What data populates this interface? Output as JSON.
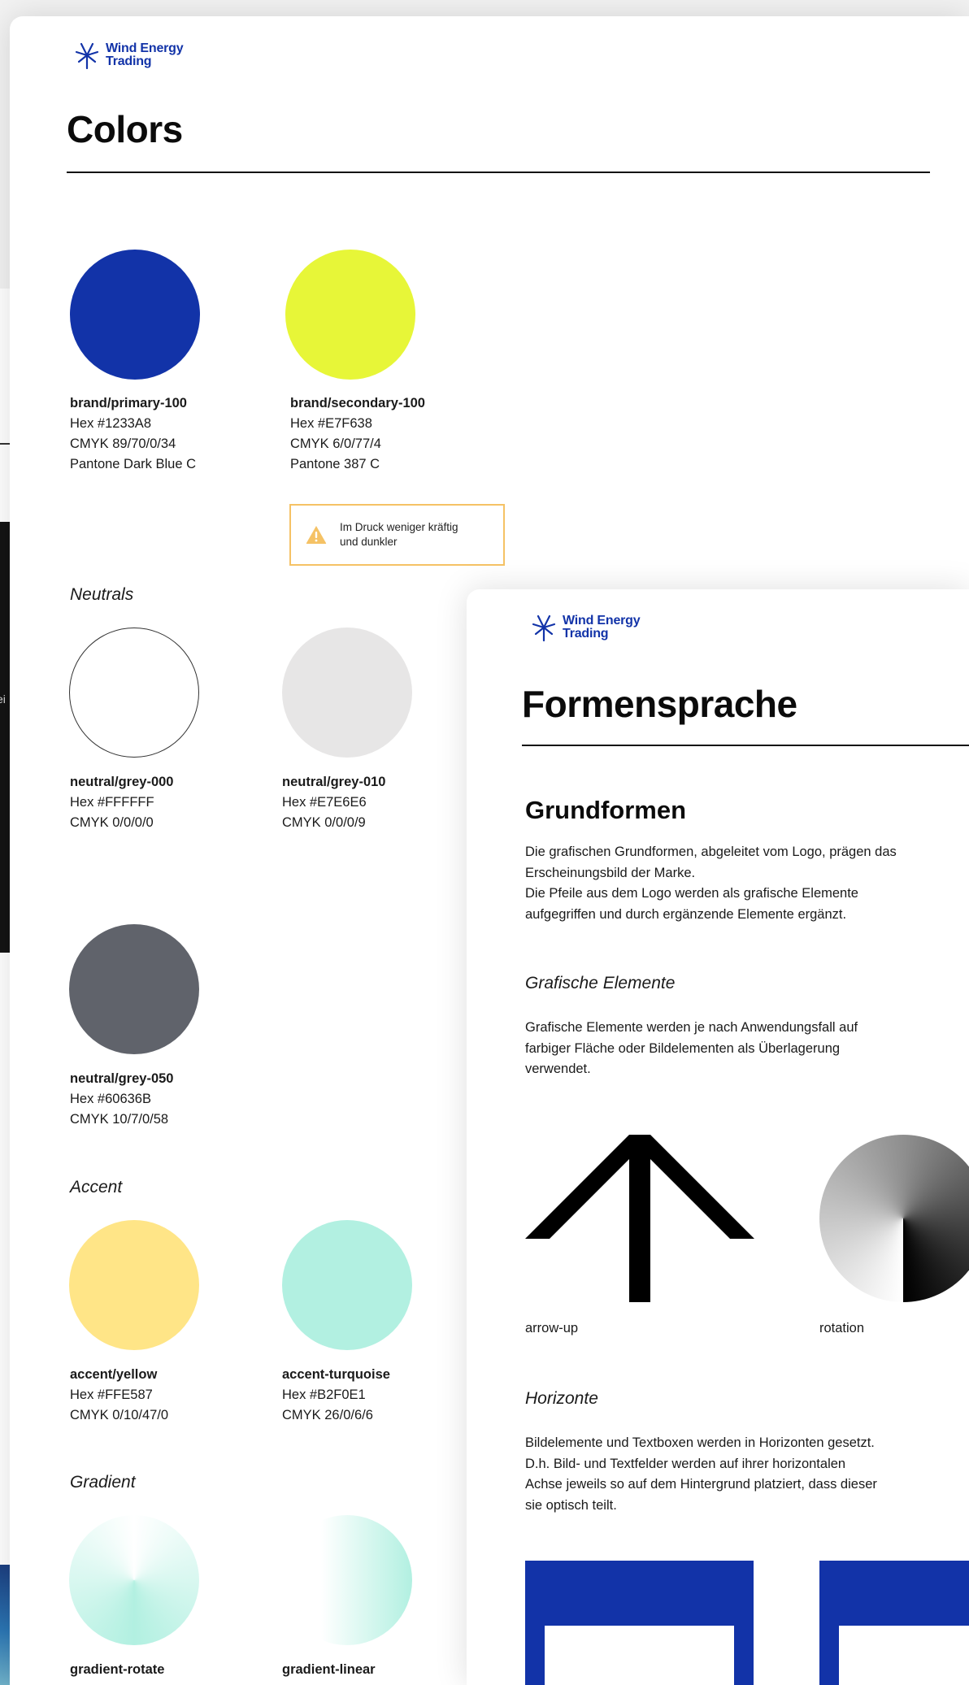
{
  "brand": {
    "logo_line1": "Wind Energy",
    "logo_line2": "Trading",
    "primary": "#1233A8"
  },
  "background": {
    "fragment_text": "ei"
  },
  "colors_page": {
    "title": "Colors",
    "swatches": [
      {
        "name": "brand/primary-100",
        "hex": "Hex #1233A8",
        "cmyk": "CMYK 89/70/0/34",
        "pantone": "Pantone Dark Blue C",
        "color": "#1233A8"
      },
      {
        "name": "brand/secondary-100",
        "hex": "Hex #E7F638",
        "cmyk": "CMYK 6/0/77/4",
        "pantone": "Pantone 387 C",
        "color": "#E7F638"
      }
    ],
    "warning": {
      "icon": "warning-icon",
      "text_line1": "Im Druck weniger kräftig",
      "text_line2": "und dunkler",
      "color": "#F5C265"
    },
    "neutrals": {
      "label": "Neutrals",
      "swatches": [
        {
          "name": "neutral/grey-000",
          "hex": "Hex #FFFFFF",
          "cmyk": "CMYK 0/0/0/0",
          "color": "#FFFFFF"
        },
        {
          "name": "neutral/grey-010",
          "hex": "Hex #E7E6E6",
          "cmyk": "CMYK 0/0/0/9",
          "color": "#E7E6E6"
        },
        {
          "name": "neutral/grey-050",
          "hex": "Hex #60636B",
          "cmyk": "CMYK 10/7/0/58",
          "color": "#60636B"
        }
      ]
    },
    "accent": {
      "label": "Accent",
      "swatches": [
        {
          "name": "accent/yellow",
          "hex": "Hex #FFE587",
          "cmyk": "CMYK 0/10/47/0",
          "color": "#FFE587"
        },
        {
          "name": "accent-turquoise",
          "hex": "Hex #B2F0E1",
          "cmyk": "CMYK 26/0/6/6",
          "color": "#B2F0E1"
        }
      ]
    },
    "gradient": {
      "label": "Gradient",
      "swatches": [
        {
          "name": "gradient-rotate"
        },
        {
          "name": "gradient-linear"
        }
      ]
    }
  },
  "forms_page": {
    "title": "Formensprache",
    "section_title": "Grundformen",
    "intro": [
      "Die grafischen Grundformen, abgeleitet vom Logo, prägen das",
      "Erscheinungsbild der Marke.",
      "Die Pfeile aus dem Logo werden als grafische Elemente",
      "aufgegriffen und durch ergänzende Elemente ergänzt."
    ],
    "elements": {
      "label": "Grafische Elemente",
      "text": [
        "Grafische Elemente werden je nach Anwendungsfall auf",
        "farbiger Fläche oder Bildelementen als Überlagerung",
        "verwendet."
      ],
      "items": [
        {
          "caption": "arrow-up",
          "icon": "arrow-up-icon"
        },
        {
          "caption": "rotation",
          "icon": "rotation-icon"
        }
      ]
    },
    "horizons": {
      "label": "Horizonte",
      "text": [
        "Bildelemente und Textboxen werden in Horizonten gesetzt.",
        "D.h. Bild- und Textfelder werden auf ihrer horizontalen",
        "Achse jeweils so auf dem Hintergrund platziert, dass dieser",
        "sie optisch teilt."
      ]
    }
  }
}
